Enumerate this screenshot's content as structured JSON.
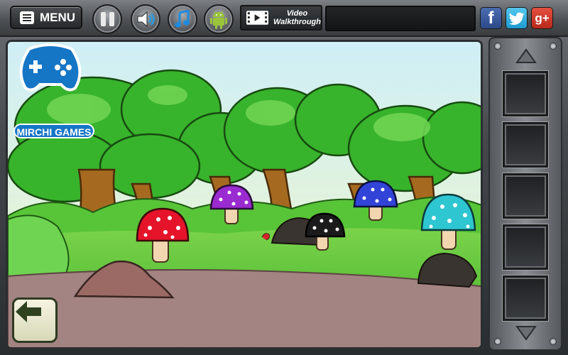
{
  "toolbar": {
    "menu_label": "MENU",
    "video_line1": "Video",
    "video_line2": "Walkthrough",
    "facebook_label": "f",
    "googleplus_label": "g+",
    "icons": [
      "hamburger-icon",
      "pause-icon",
      "sound-icon",
      "music-icon",
      "android-icon",
      "film-icon",
      "facebook-icon",
      "twitter-icon",
      "google-plus-icon"
    ]
  },
  "logo": {
    "text": "MIRCHI GAMES",
    "icon": "gamepad-icon"
  },
  "scene": {
    "colors": {
      "sky": "#dff3f7",
      "grass": "#5cc338",
      "path": "#a38483",
      "leaves": "#38b32c",
      "trunk": "#a56a20"
    },
    "mushrooms": [
      {
        "name": "red-mushroom",
        "cap": "#e5142a"
      },
      {
        "name": "purple-mushroom",
        "cap": "#9a2bd0"
      },
      {
        "name": "black-mushroom",
        "cap": "#1b1b1b"
      },
      {
        "name": "blue-mushroom",
        "cap": "#3244d8"
      },
      {
        "name": "cyan-mushroom",
        "cap": "#2ec6d0"
      }
    ]
  },
  "navigation": {
    "back_icon": "arrow-left-icon"
  },
  "inventory": {
    "up_icon": "chevron-up-icon",
    "down_icon": "chevron-down-icon",
    "slots": [
      "",
      "",
      "",
      "",
      ""
    ]
  }
}
